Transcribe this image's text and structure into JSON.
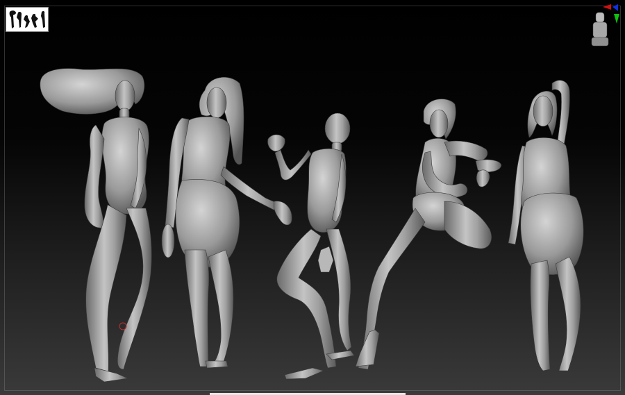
{
  "viewport": {
    "background_top": "#000000",
    "background_bottom": "#3a3a3a",
    "mesh_color": "#a8a8a8",
    "mesh_highlight": "#d6d6d6",
    "mesh_shadow": "#555555"
  },
  "thumbnail": {
    "icon": "poses-thumbnail-icon"
  },
  "gizmo": {
    "icon": "orientation-gizmo-icon",
    "axis_x_color": "#d01010",
    "axis_y_color": "#10c010",
    "axis_z_color": "#1030e0"
  },
  "figures": [
    {
      "name": "figure-1-windblown-hair"
    },
    {
      "name": "figure-2-long-hair"
    },
    {
      "name": "figure-3-kneeling-step"
    },
    {
      "name": "figure-4-high-kick"
    },
    {
      "name": "figure-5-arm-raised"
    }
  ]
}
